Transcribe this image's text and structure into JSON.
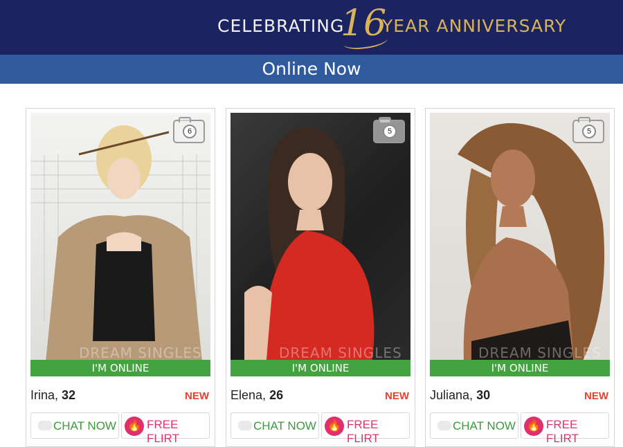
{
  "banner": {
    "left_text": "CELEBRATING",
    "number": "16",
    "right_text": "YEAR ANNIVERSARY"
  },
  "section": {
    "title": "Online Now"
  },
  "watermark": "DREAM SINGLES",
  "profiles": [
    {
      "name": "Irina",
      "age": "32",
      "photo_count": "6",
      "status": "I'M ONLINE",
      "badge": "NEW",
      "chat_label": "CHAT NOW",
      "flirt_label": "FREE FLIRT"
    },
    {
      "name": "Elena",
      "age": "26",
      "photo_count": "5",
      "status": "I'M ONLINE",
      "badge": "NEW",
      "chat_label": "CHAT NOW",
      "flirt_label": "FREE FLIRT"
    },
    {
      "name": "Juliana",
      "age": "30",
      "photo_count": "5",
      "status": "I'M ONLINE",
      "badge": "NEW",
      "chat_label": "CHAT NOW",
      "flirt_label": "FREE FLIRT"
    }
  ],
  "colors": {
    "banner_bg": "#1b2460",
    "gold": "#d8b35c",
    "subbar_bg": "#2f5b9e",
    "online_green": "#43a43f",
    "new_red": "#e8402e",
    "flirt_pink": "#e0306c"
  },
  "icons": {
    "camera": "camera-icon",
    "chat": "chat-bubble-icon",
    "flirt": "flame-icon"
  }
}
